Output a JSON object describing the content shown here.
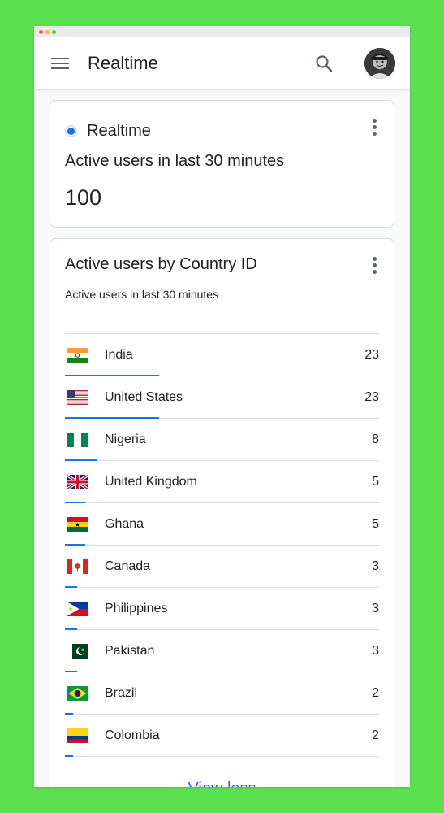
{
  "app": {
    "title": "Realtime"
  },
  "card_realtime": {
    "label": "Realtime",
    "subtitle": "Active users in last 30 minutes",
    "value": "100"
  },
  "card_country": {
    "title": "Active users by Country ID",
    "caption": "Active users in last 30 minutes",
    "max_count": 23,
    "rows": [
      {
        "country": "India",
        "count": "23",
        "flag": "flag-india"
      },
      {
        "country": "United States",
        "count": "23",
        "flag": "flag-united-states"
      },
      {
        "country": "Nigeria",
        "count": "8",
        "flag": "flag-nigeria"
      },
      {
        "country": "United Kingdom",
        "count": "5",
        "flag": "flag-united-kingdom"
      },
      {
        "country": "Ghana",
        "count": "5",
        "flag": "flag-ghana"
      },
      {
        "country": "Canada",
        "count": "3",
        "flag": "flag-canada"
      },
      {
        "country": "Philippines",
        "count": "3",
        "flag": "flag-philippines"
      },
      {
        "country": "Pakistan",
        "count": "3",
        "flag": "flag-pakistan"
      },
      {
        "country": "Brazil",
        "count": "2",
        "flag": "flag-brazil"
      },
      {
        "country": "Colombia",
        "count": "2",
        "flag": "flag-colombia"
      }
    ],
    "view_less_label": "View less"
  },
  "colors": {
    "accent": "#1a73e8",
    "background": "#5be04f"
  }
}
